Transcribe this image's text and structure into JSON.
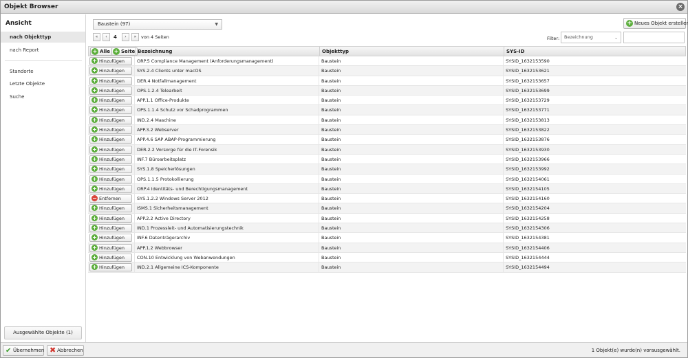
{
  "window": {
    "title": "Objekt Browser"
  },
  "sidebar": {
    "heading": "Ansicht",
    "items": [
      {
        "label": "nach Objekttyp"
      },
      {
        "label": "nach Report"
      },
      {
        "label": "Standorte"
      },
      {
        "label": "Letzte Objekte"
      },
      {
        "label": "Suche"
      }
    ],
    "selected_button": "Ausgewählte Objekte (1)"
  },
  "toolbar": {
    "object_type_select": "Baustein (97)",
    "pager": {
      "first": "«",
      "prev": "‹",
      "page": "4",
      "next": "›",
      "last": "»",
      "of_text": "von 4 Seiten"
    },
    "new_object_button": "Neues Objekt erstellen",
    "filter_label": "Filter:",
    "filter_select": "Bezeichnung",
    "filter_input": ""
  },
  "grid": {
    "all_button": "Alle",
    "page_button": "Seite",
    "headers": [
      "Bezeichnung",
      "Objekttyp",
      "SYS-ID"
    ],
    "rows": [
      {
        "action": "Hinzufügen",
        "name": "ORP.5 Compliance Management (Anforderungsmanagement)",
        "type": "Baustein",
        "sysid": "SYSID_1632153590"
      },
      {
        "action": "Hinzufügen",
        "name": "SYS.2.4 Clients unter macOS",
        "type": "Baustein",
        "sysid": "SYSID_1632153621"
      },
      {
        "action": "Hinzufügen",
        "name": "DER.4 Notfallmanagement",
        "type": "Baustein",
        "sysid": "SYSID_1632153657"
      },
      {
        "action": "Hinzufügen",
        "name": "OPS.1.2.4 Telearbeit",
        "type": "Baustein",
        "sysid": "SYSID_1632153699"
      },
      {
        "action": "Hinzufügen",
        "name": "APP.1.1 Office-Produkte",
        "type": "Baustein",
        "sysid": "SYSID_1632153729"
      },
      {
        "action": "Hinzufügen",
        "name": "OPS.1.1.4 Schutz vor Schadprogrammen",
        "type": "Baustein",
        "sysid": "SYSID_1632153771"
      },
      {
        "action": "Hinzufügen",
        "name": "IND.2.4 Maschine",
        "type": "Baustein",
        "sysid": "SYSID_1632153813"
      },
      {
        "action": "Hinzufügen",
        "name": "APP.3.2 Webserver",
        "type": "Baustein",
        "sysid": "SYSID_1632153822"
      },
      {
        "action": "Hinzufügen",
        "name": "APP.4.6 SAP ABAP-Programmierung",
        "type": "Baustein",
        "sysid": "SYSID_1632153876"
      },
      {
        "action": "Hinzufügen",
        "name": "DER.2.2 Vorsorge für die IT-Forensik",
        "type": "Baustein",
        "sysid": "SYSID_1632153930"
      },
      {
        "action": "Hinzufügen",
        "name": "INF.7 Büroarbeitsplatz",
        "type": "Baustein",
        "sysid": "SYSID_1632153966"
      },
      {
        "action": "Hinzufügen",
        "name": "SYS.1.8 Speicherlösungen",
        "type": "Baustein",
        "sysid": "SYSID_1632153992"
      },
      {
        "action": "Hinzufügen",
        "name": "OPS.1.1.5 Protokollierung",
        "type": "Baustein",
        "sysid": "SYSID_1632154061"
      },
      {
        "action": "Hinzufügen",
        "name": "ORP.4 Identitäts- und Berechtigungsmanagement",
        "type": "Baustein",
        "sysid": "SYSID_1632154105"
      },
      {
        "action": "Entfernen",
        "name": "SYS.1.2.2 Windows Server 2012",
        "type": "Baustein",
        "sysid": "SYSID_1632154160"
      },
      {
        "action": "Hinzufügen",
        "name": "ISMS.1 Sicherheitsmanagement",
        "type": "Baustein",
        "sysid": "SYSID_1632154204"
      },
      {
        "action": "Hinzufügen",
        "name": "APP.2.2 Active Directory",
        "type": "Baustein",
        "sysid": "SYSID_1632154258"
      },
      {
        "action": "Hinzufügen",
        "name": "IND.1 Prozessleit- und Automatisierungstechnik",
        "type": "Baustein",
        "sysid": "SYSID_1632154306"
      },
      {
        "action": "Hinzufügen",
        "name": "INF.6 Datenträgerarchiv",
        "type": "Baustein",
        "sysid": "SYSID_1632154381"
      },
      {
        "action": "Hinzufügen",
        "name": "APP.1.2 Webbrowser",
        "type": "Baustein",
        "sysid": "SYSID_1632154406"
      },
      {
        "action": "Hinzufügen",
        "name": "CON.10 Entwicklung von Webanwendungen",
        "type": "Baustein",
        "sysid": "SYSID_1632154444"
      },
      {
        "action": "Hinzufügen",
        "name": "IND.2.1 Allgemeine ICS-Komponente",
        "type": "Baustein",
        "sysid": "SYSID_1632154494"
      }
    ]
  },
  "footer": {
    "accept_button": "Übernehmen",
    "cancel_button": "Abbrechen",
    "status": "1 Objekt(e) wurde(n) vorausgewählt."
  },
  "colors": {
    "add": "#5cae3c",
    "remove": "#d9463c"
  }
}
